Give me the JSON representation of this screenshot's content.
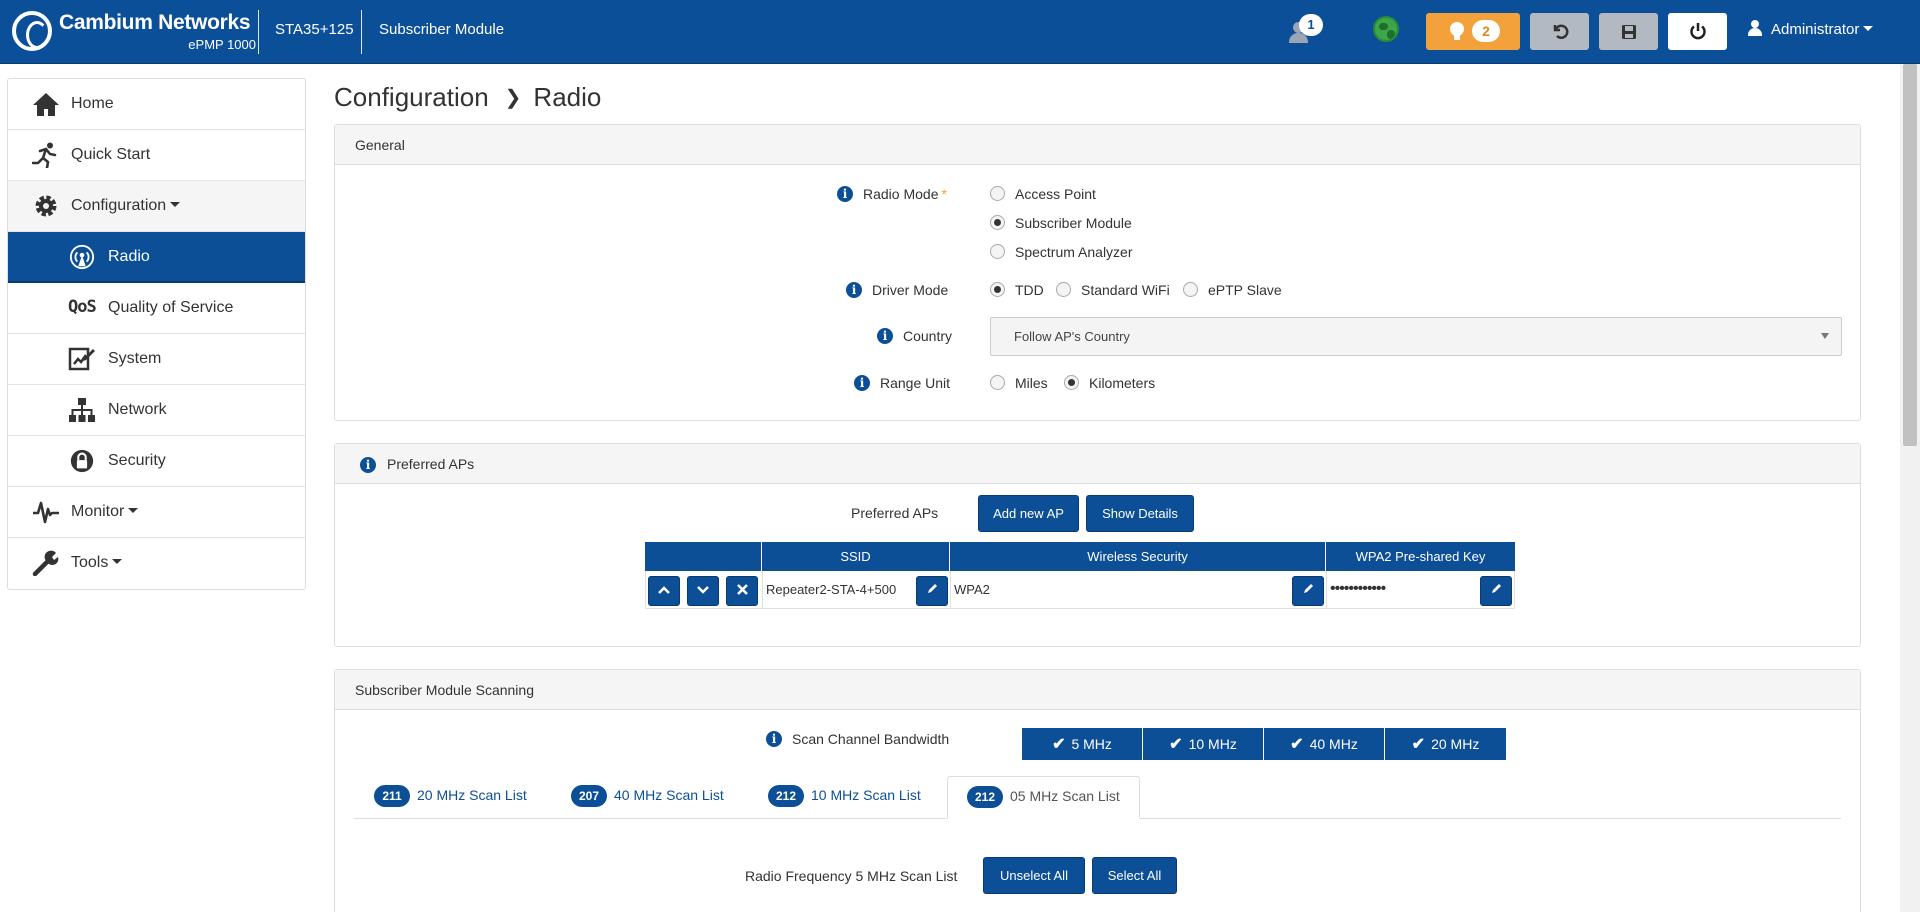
{
  "header": {
    "brand": "Cambium Networks",
    "product": "ePMP 1000",
    "device_name": "STA35+125",
    "device_mode": "Subscriber Module",
    "user_badge": "1",
    "alerts_count": "2",
    "user_menu_label": "Administrator"
  },
  "sidebar": {
    "items": [
      {
        "label": "Home",
        "icon": "home-icon"
      },
      {
        "label": "Quick Start",
        "icon": "running-man-icon"
      },
      {
        "label": "Configuration",
        "icon": "gear-icon"
      },
      {
        "label": "Radio",
        "icon": "radio-tower-icon"
      },
      {
        "label": "Quality of Service",
        "icon": "qos-icon"
      },
      {
        "label": "System",
        "icon": "system-icon"
      },
      {
        "label": "Network",
        "icon": "network-icon"
      },
      {
        "label": "Security",
        "icon": "lock-icon"
      },
      {
        "label": "Monitor",
        "icon": "pulse-icon"
      },
      {
        "label": "Tools",
        "icon": "wrench-icon"
      }
    ]
  },
  "breadcrumb": {
    "section": "Configuration",
    "page": "Radio"
  },
  "general": {
    "title": "General",
    "radio_mode": {
      "label": "Radio Mode",
      "required_mark": "*",
      "options": [
        "Access Point",
        "Subscriber Module",
        "Spectrum Analyzer"
      ],
      "selected": "Subscriber Module"
    },
    "driver_mode": {
      "label": "Driver Mode",
      "options": [
        "TDD",
        "Standard WiFi",
        "ePTP Slave"
      ],
      "selected": "TDD"
    },
    "country": {
      "label": "Country",
      "value": "Follow AP's Country"
    },
    "range_unit": {
      "label": "Range Unit",
      "options": [
        "Miles",
        "Kilometers"
      ],
      "selected": "Kilometers"
    }
  },
  "preferred_aps": {
    "title": "Preferred APs",
    "field_label": "Preferred APs",
    "add_button": "Add new AP",
    "details_button": "Show Details",
    "columns": [
      "",
      "SSID",
      "Wireless Security",
      "WPA2 Pre-shared Key"
    ],
    "rows": [
      {
        "ssid": "Repeater2-STA-4+500",
        "security": "WPA2",
        "psk": "••••••••••••"
      }
    ]
  },
  "scanning": {
    "title": "Subscriber Module Scanning",
    "bandwidth_label": "Scan Channel Bandwidth",
    "bandwidths": [
      "5 MHz",
      "10 MHz",
      "40 MHz",
      "20 MHz"
    ],
    "tabs": [
      {
        "count": "211",
        "label": "20 MHz Scan List"
      },
      {
        "count": "207",
        "label": "40 MHz Scan List"
      },
      {
        "count": "212",
        "label": "10 MHz Scan List"
      },
      {
        "count": "212",
        "label": "05 MHz Scan List"
      }
    ],
    "active_tab": "05 MHz Scan List",
    "freq_label": "Radio Frequency 5 MHz Scan List",
    "unselect_all": "Unselect All",
    "select_all": "Select All"
  },
  "colors": {
    "brand_blue": "#0b4f99",
    "alert_orange": "#f3a23b",
    "globe_green": "#3da64a"
  }
}
